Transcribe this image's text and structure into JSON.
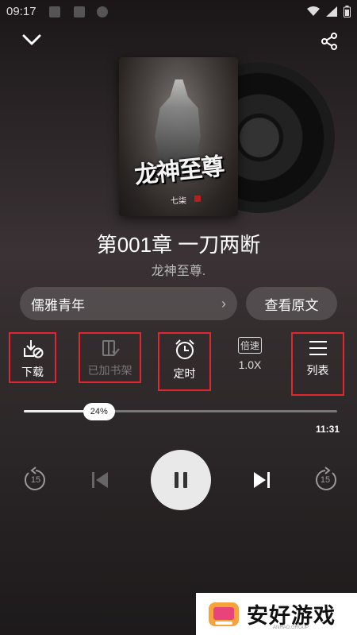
{
  "status_bar": {
    "time": "09:17"
  },
  "header": {
    "collapse_icon": "chevron-down-icon",
    "share_icon": "share-icon"
  },
  "cover": {
    "title": "龙神至尊",
    "author": "七柒"
  },
  "player": {
    "chapter_title": "第001章 一刀两断",
    "book_name": "龙神至尊."
  },
  "voice": {
    "selected": "儒雅青年",
    "view_original_label": "查看原文"
  },
  "actions": [
    {
      "label": "下载",
      "icon": "download-icon",
      "enabled": true
    },
    {
      "label": "已加书架",
      "icon": "bookshelf-icon",
      "enabled": false
    },
    {
      "label": "定时",
      "icon": "alarm-icon",
      "enabled": true
    },
    {
      "icon_text": "倍速",
      "label": "1.0X",
      "icon": "speed-icon",
      "enabled": true
    },
    {
      "label": "列表",
      "icon": "list-icon",
      "enabled": true
    }
  ],
  "progress": {
    "percent_label": "24%",
    "fraction": 0.24,
    "duration": "11:31"
  },
  "controls": {
    "rewind": "15",
    "forward": "15"
  },
  "watermark": {
    "text": "安好游戏",
    "sub": "ANHAO.GROUP"
  }
}
